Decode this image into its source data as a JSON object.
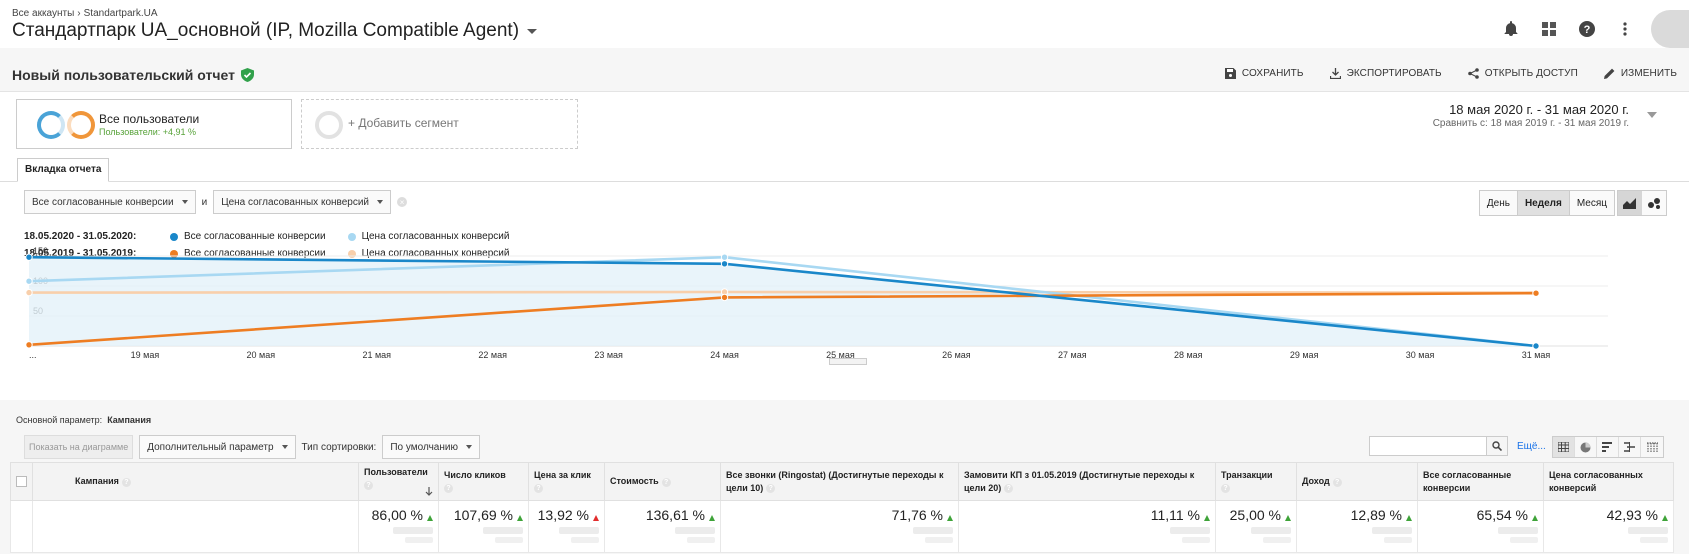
{
  "header": {
    "breadcrumb": [
      "Все аккаунты",
      "Standartpark.UA"
    ],
    "account_title": "Стандартпарк UA_основной (IP, Mozilla Compatible Agent)",
    "icons": [
      "bell-icon",
      "apps-grid-icon",
      "help-icon",
      "more-vert-icon",
      "avatar"
    ]
  },
  "report": {
    "title": "Новый пользовательский отчет",
    "actions": {
      "save": "СОХРАНИТЬ",
      "export": "ЭКСПОРТИРОВАТЬ",
      "share": "ОТКРЫТЬ ДОСТУП",
      "edit": "ИЗМЕНИТЬ"
    }
  },
  "segments": {
    "active": {
      "name": "Все пользователи",
      "sub": "Пользователи: +4,91 %"
    },
    "add_label": "+ Добавить сегмент"
  },
  "date_range": {
    "current": "18 мая 2020 г. - 31 мая 2020 г.",
    "compare": "Сравнить с: 18 мая 2019 г. - 31 мая 2019 г."
  },
  "tab": {
    "label": "Вкладка отчета"
  },
  "chart_controls": {
    "metric1": "Все согласованные конверсии",
    "joiner": "и",
    "metric2": "Цена согласованных конверсий",
    "periods": [
      "День",
      "Неделя",
      "Месяц"
    ],
    "active_period": "Неделя"
  },
  "legend": {
    "period1": "18.05.2020 - 31.05.2020:",
    "period2": "18.05.2019 - 31.05.2019:",
    "m1": "Все согласованные конверсии",
    "m2": "Цена согласованных конверсий"
  },
  "chart_data": {
    "type": "line",
    "x": [
      "...",
      "19 мая",
      "20 мая",
      "21 мая",
      "22 мая",
      "23 мая",
      "24 мая",
      "25 мая",
      "26 мая",
      "27 мая",
      "28 мая",
      "29 мая",
      "30 мая",
      "31 мая"
    ],
    "y_ticks": [
      "150",
      "100",
      "50"
    ],
    "ylim": [
      0,
      170
    ],
    "grid": true,
    "series": [
      {
        "name": "Все согласованные конверсии",
        "period": "18.05.2020 - 31.05.2020",
        "color": "#1a87c9",
        "points": [
          [
            0,
            148
          ],
          [
            6,
            137
          ],
          [
            13,
            0
          ]
        ]
      },
      {
        "name": "Цена согласованных конверсий",
        "period": "18.05.2020 - 31.05.2020",
        "color": "#a8d8f2",
        "points": [
          [
            0,
            108
          ],
          [
            6,
            148
          ],
          [
            13,
            0
          ]
        ]
      },
      {
        "name": "Все согласованные конверсии",
        "period": "18.05.2019 - 31.05.2019",
        "color": "#ee7d22",
        "points": [
          [
            0,
            2
          ],
          [
            6,
            81
          ],
          [
            13,
            88
          ]
        ]
      },
      {
        "name": "Цена согласованных конверсий",
        "period": "18.05.2019 - 31.05.2019",
        "color": "#f8cfab",
        "points": [
          [
            0,
            89
          ],
          [
            6,
            90
          ],
          [
            13,
            89
          ]
        ]
      }
    ]
  },
  "dimension": {
    "label": "Основной параметр:",
    "value": "Кампания"
  },
  "table_toolbar": {
    "plot_button": "Показать на диаграмме",
    "secondary": "Дополнительный параметр",
    "sort_label": "Тип сортировки:",
    "sort_value": "По умолчанию",
    "more": "Ещё..."
  },
  "table": {
    "columns": [
      {
        "label": "Кампания"
      },
      {
        "label": "Пользователи",
        "sort": true
      },
      {
        "label": "Число кликов"
      },
      {
        "label": "Цена за клик"
      },
      {
        "label": "Стоимость"
      },
      {
        "label": "Все звонки (Ringostat) (Достигнутые переходы к цели 10)"
      },
      {
        "label": "Замовити КП з 01.05.2019 (Достигнутые переходы к цели 20)"
      },
      {
        "label": "Транзакции"
      },
      {
        "label": "Доход"
      },
      {
        "label": "Все согласованные конверсии"
      },
      {
        "label": "Цена согласованных конверсий"
      }
    ],
    "totals": [
      {
        "value": "86,00 %",
        "trend": "up"
      },
      {
        "value": "107,69 %",
        "trend": "up"
      },
      {
        "value": "13,92 %",
        "trend": "down"
      },
      {
        "value": "136,61 %",
        "trend": "up"
      },
      {
        "value": "71,76 %",
        "trend": "up"
      },
      {
        "value": "11,11 %",
        "trend": "up"
      },
      {
        "value": "25,00 %",
        "trend": "up"
      },
      {
        "value": "12,89 %",
        "trend": "up"
      },
      {
        "value": "65,54 %",
        "trend": "up"
      },
      {
        "value": "42,93 %",
        "trend": "up"
      }
    ]
  }
}
